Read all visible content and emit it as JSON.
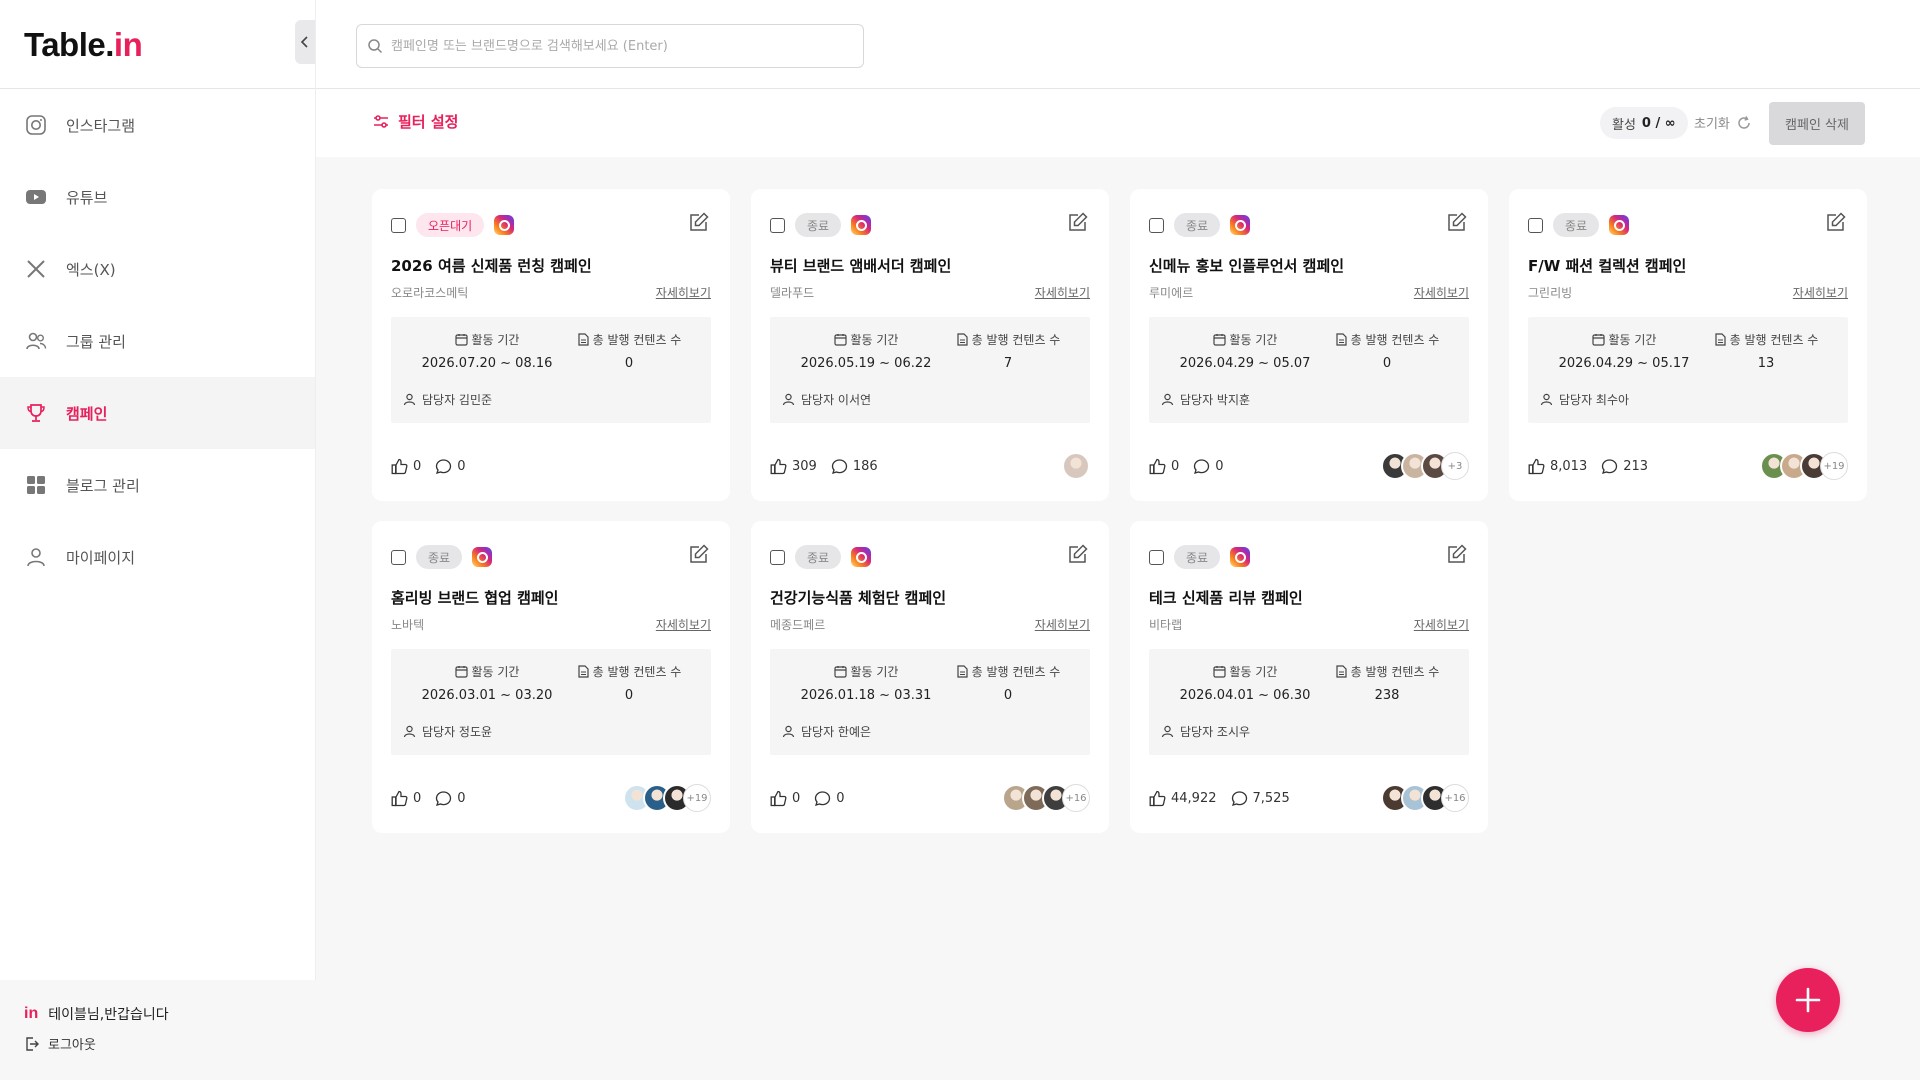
{
  "app": {
    "logo_main": "Table.",
    "logo_accent": "in"
  },
  "search": {
    "placeholder": "캠페인명 또는 브랜드명으로 검색해보세요 (Enter)"
  },
  "sidebar": {
    "items": [
      {
        "label": "인스타그램",
        "icon": "instagram-icon"
      },
      {
        "label": "유튜브",
        "icon": "youtube-icon"
      },
      {
        "label": "엑스(X)",
        "icon": "x-icon"
      },
      {
        "label": "그룹 관리",
        "icon": "group-icon"
      },
      {
        "label": "캠페인",
        "icon": "trophy-icon",
        "active": true
      },
      {
        "label": "블로그 관리",
        "icon": "grid-icon"
      },
      {
        "label": "마이페이지",
        "icon": "user-icon"
      }
    ],
    "footer": {
      "mini_logo": "in",
      "greeting": "테이블님,반갑습니다",
      "logout": "로그아웃"
    }
  },
  "toolbar": {
    "filter_label": "필터 설정",
    "active_label": "활성",
    "active_value": "0 / ∞",
    "reset_label": "초기화",
    "delete_label": "캠페인 삭제"
  },
  "labels": {
    "period": "활동 기간",
    "content_count": "총 발행 컨텐츠 수",
    "manager_prefix": "담당자",
    "detail": "자세히보기"
  },
  "colors": {
    "accent": "#e8205c",
    "badge_ended_bg": "#e6e6e8",
    "badge_open_bg": "#fde6ee"
  },
  "campaigns": [
    {
      "status": "오픈대기",
      "status_type": "open",
      "title": "2026 여름 신제품 런칭 캠페인",
      "brand": "오로라코스메틱",
      "period": "2026.07.20 ~ 08.16",
      "count": "0",
      "manager": "담당자 김민준",
      "likes": "0",
      "comments": "0",
      "avatars": [],
      "more": ""
    },
    {
      "status": "종료",
      "status_type": "ended",
      "title": "뷰티 브랜드 앰배서더 캠페인",
      "brand": "델라푸드",
      "period": "2026.05.19 ~ 06.22",
      "count": "7",
      "manager": "담당자 이서연",
      "likes": "309",
      "comments": "186",
      "avatars": [
        "#d8c7bd"
      ],
      "more": ""
    },
    {
      "status": "종료",
      "status_type": "ended",
      "title": "신메뉴 홍보 인플루언서 캠페인",
      "brand": "루미에르",
      "period": "2026.04.29 ~ 05.07",
      "count": "0",
      "manager": "담당자 박지훈",
      "likes": "0",
      "comments": "0",
      "avatars": [
        "#3a3a3a",
        "#c9b49f",
        "#5b4a42"
      ],
      "more": "+3"
    },
    {
      "status": "종료",
      "status_type": "ended",
      "title": "F/W 패션 컬렉션 캠페인",
      "brand": "그린리빙",
      "period": "2026.04.29 ~ 05.17",
      "count": "13",
      "manager": "담당자 최수아",
      "likes": "8,013",
      "comments": "213",
      "avatars": [
        "#6a8f4e",
        "#c8a98c",
        "#4a3b36"
      ],
      "more": "+19"
    },
    {
      "status": "종료",
      "status_type": "ended",
      "title": "홈리빙 브랜드 협업 캠페인",
      "brand": "노바텍",
      "period": "2026.03.01 ~ 03.20",
      "count": "0",
      "manager": "담당자 정도윤",
      "likes": "0",
      "comments": "0",
      "avatars": [
        "#cfe3ef",
        "#2a5f8a",
        "#2b2b2b"
      ],
      "more": "+19"
    },
    {
      "status": "종료",
      "status_type": "ended",
      "title": "건강기능식품 체험단 캠페인",
      "brand": "메종드페르",
      "period": "2026.01.18 ~ 03.31",
      "count": "0",
      "manager": "담당자 한예은",
      "likes": "0",
      "comments": "0",
      "avatars": [
        "#b9a58c",
        "#7d6a58",
        "#3e3e3e"
      ],
      "more": "+16"
    },
    {
      "status": "종료",
      "status_type": "ended",
      "title": "테크 신제품 리뷰 캠페인",
      "brand": "비타랩",
      "period": "2026.04.01 ~ 06.30",
      "count": "238",
      "manager": "담당자 조시우",
      "likes": "44,922",
      "comments": "7,525",
      "avatars": [
        "#4b3a30",
        "#a8c2d6",
        "#2e2e2e"
      ],
      "more": "+16"
    }
  ]
}
